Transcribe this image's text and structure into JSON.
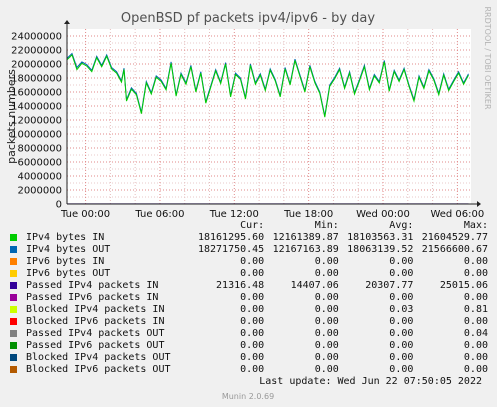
{
  "chart_data": {
    "type": "line",
    "title": "OpenBSD pf packets ipv4/ipv6 - by day",
    "ylabel": "packets numbers",
    "side_label": "RRDTOOL / TOBI OETIKER",
    "ylim": [
      0,
      25000000
    ],
    "yticks": [
      0,
      2000000,
      4000000,
      6000000,
      8000000,
      10000000,
      12000000,
      14000000,
      16000000,
      18000000,
      20000000,
      22000000,
      24000000
    ],
    "ytick_labels": [
      "0",
      "2000000",
      "4000000",
      "6000000",
      "8000000",
      "10000000",
      "12000000",
      "14000000",
      "16000000",
      "18000000",
      "20000000",
      "22000000",
      "24000000"
    ],
    "xlim_hours": [
      -1.5,
      31.1
    ],
    "xticks": [
      {
        "label": "Tue 00:00",
        "hour": 0
      },
      {
        "label": "Tue 06:00",
        "hour": 6
      },
      {
        "label": "Tue 12:00",
        "hour": 12
      },
      {
        "label": "Tue 18:00",
        "hour": 18
      },
      {
        "label": "Wed 00:00",
        "hour": 24
      },
      {
        "label": "Wed 06:00",
        "hour": 30
      }
    ],
    "grid": true,
    "series": [
      {
        "name": "IPv4 bytes IN",
        "color": "#00cc00",
        "x": [
          -1.5,
          -1.1,
          -0.7,
          -0.3,
          0.1,
          0.5,
          0.9,
          1.3,
          1.7,
          2.1,
          2.5,
          2.9,
          3.1,
          3.3,
          3.7,
          4.1,
          4.5,
          4.9,
          5.3,
          5.7,
          6.1,
          6.5,
          6.9,
          7.3,
          7.7,
          8.1,
          8.5,
          8.9,
          9.3,
          9.7,
          10.1,
          10.5,
          10.9,
          11.3,
          11.7,
          12.1,
          12.5,
          12.9,
          13.3,
          13.7,
          14.1,
          14.5,
          14.9,
          15.3,
          15.7,
          16.1,
          16.5,
          16.9,
          17.3,
          17.7,
          18.1,
          18.5,
          18.9,
          19.3,
          19.7,
          20.1,
          20.5,
          20.9,
          21.3,
          21.7,
          22.1,
          22.5,
          22.9,
          23.3,
          23.7,
          24.1,
          24.5,
          24.9,
          25.3,
          25.7,
          26.1,
          26.5,
          26.9,
          27.3,
          27.7,
          28.1,
          28.5,
          28.9,
          29.3,
          29.7,
          30.1,
          30.5,
          30.9
        ],
        "values": [
          20600000,
          21300000,
          19200000,
          20100000,
          19700000,
          18900000,
          20900000,
          19600000,
          21100000,
          19300000,
          18700000,
          17400000,
          19200000,
          14700000,
          16400000,
          15600000,
          12900000,
          17300000,
          15700000,
          18100000,
          17500000,
          16300000,
          20100000,
          15400000,
          18500000,
          17100000,
          19600000,
          16000000,
          18700000,
          14400000,
          16700000,
          19000000,
          17200000,
          20000000,
          15300000,
          18500000,
          17800000,
          15000000,
          19800000,
          17100000,
          18400000,
          16200000,
          19100000,
          17600000,
          15300000,
          19300000,
          17000000,
          20500000,
          18200000,
          16000000,
          19600000,
          17300000,
          15800000,
          12400000,
          16800000,
          17900000,
          19200000,
          16500000,
          18700000,
          15700000,
          17600000,
          19600000,
          16300000,
          18300000,
          17300000,
          20300000,
          16100000,
          18900000,
          17500000,
          19200000,
          16800000,
          14700000,
          18100000,
          16500000,
          19000000,
          17700000,
          15600000,
          18400000,
          16200000,
          17500000,
          18700000,
          17100000,
          18400000
        ]
      },
      {
        "name": "IPv4 bytes OUT",
        "color": "#0066b3",
        "x": [
          -1.5,
          -1.1,
          -0.7,
          -0.3,
          0.1,
          0.5,
          0.9,
          1.3,
          1.7,
          2.1,
          2.5,
          2.9,
          3.1,
          3.3,
          3.7,
          4.1,
          4.5,
          4.9,
          5.3,
          5.7,
          6.1,
          6.5,
          6.9,
          7.3,
          7.7,
          8.1,
          8.5,
          8.9,
          9.3,
          9.7,
          10.1,
          10.5,
          10.9,
          11.3,
          11.7,
          12.1,
          12.5,
          12.9,
          13.3,
          13.7,
          14.1,
          14.5,
          14.9,
          15.3,
          15.7,
          16.1,
          16.5,
          16.9,
          17.3,
          17.7,
          18.1,
          18.5,
          18.9,
          19.3,
          19.7,
          20.1,
          20.5,
          20.9,
          21.3,
          21.7,
          22.1,
          22.5,
          22.9,
          23.3,
          23.7,
          24.1,
          24.5,
          24.9,
          25.3,
          25.7,
          26.1,
          26.5,
          26.9,
          27.3,
          27.7,
          28.1,
          28.5,
          28.9,
          29.3,
          29.7,
          30.1,
          30.5,
          30.9
        ],
        "values": [
          20800000,
          21500000,
          19500000,
          20300000,
          19900000,
          19100000,
          21100000,
          19800000,
          21300000,
          19500000,
          18900000,
          17600000,
          19400000,
          14900000,
          16600000,
          15800000,
          13100000,
          17500000,
          15900000,
          18300000,
          17700000,
          16500000,
          20300000,
          15600000,
          18700000,
          17300000,
          19800000,
          16200000,
          18900000,
          14600000,
          16900000,
          19200000,
          17400000,
          20200000,
          15500000,
          18700000,
          18000000,
          15200000,
          20000000,
          17300000,
          18600000,
          16400000,
          19300000,
          17800000,
          15500000,
          19500000,
          17200000,
          20700000,
          18400000,
          16200000,
          19800000,
          17500000,
          16000000,
          12600000,
          17000000,
          18100000,
          19400000,
          16700000,
          18900000,
          15900000,
          17800000,
          19800000,
          16500000,
          18500000,
          17500000,
          20500000,
          16300000,
          19100000,
          17700000,
          19400000,
          17000000,
          14900000,
          18300000,
          16700000,
          19200000,
          17900000,
          15800000,
          18600000,
          16400000,
          17700000,
          18900000,
          17300000,
          18600000
        ]
      },
      {
        "name": "IPv6 bytes IN",
        "color": "#ff8000",
        "x": [
          -1.5,
          30.9
        ],
        "values": [
          0,
          0
        ]
      },
      {
        "name": "IPv6 bytes OUT",
        "color": "#ffcc00",
        "x": [
          -1.5,
          30.9
        ],
        "values": [
          0,
          0
        ]
      },
      {
        "name": "Passed IPv4 packets IN",
        "color": "#330099",
        "x": [
          -1.5,
          30.9
        ],
        "values": [
          21316,
          21316
        ]
      },
      {
        "name": "Passed IPv6 packets IN",
        "color": "#990099",
        "x": [
          -1.5,
          30.9
        ],
        "values": [
          0,
          0
        ]
      },
      {
        "name": "Blocked IPv4 packets IN",
        "color": "#ccff00",
        "x": [
          -1.5,
          30.9
        ],
        "values": [
          0,
          0
        ]
      },
      {
        "name": "Blocked IPv6 packets IN",
        "color": "#ff0000",
        "x": [
          -1.5,
          30.9
        ],
        "values": [
          0,
          0
        ]
      },
      {
        "name": "Passed IPv4 packets OUT",
        "color": "#808080",
        "x": [
          -1.5,
          30.9
        ],
        "values": [
          0,
          0
        ]
      },
      {
        "name": "Passed IPv6 packets OUT",
        "color": "#008f00",
        "x": [
          -1.5,
          30.9
        ],
        "values": [
          0,
          0
        ]
      },
      {
        "name": "Blocked IPv4 packets OUT",
        "color": "#00487d",
        "x": [
          -1.5,
          30.9
        ],
        "values": [
          0,
          0
        ]
      },
      {
        "name": "Blocked IPv6 packets OUT",
        "color": "#b35a00",
        "x": [
          -1.5,
          30.9
        ],
        "values": [
          0,
          0
        ]
      }
    ]
  },
  "legend": {
    "headers": {
      "cur": "Cur:",
      "min": "Min:",
      "avg": "Avg:",
      "max": "Max:"
    },
    "rows": [
      {
        "name": "IPv4 bytes IN",
        "color": "#00cc00",
        "cur": "18161295.60",
        "min": "12161389.87",
        "avg": "18103563.31",
        "max": "21604529.77"
      },
      {
        "name": "IPv4 bytes OUT",
        "color": "#0066b3",
        "cur": "18271750.45",
        "min": "12167163.89",
        "avg": "18063139.52",
        "max": "21566600.67"
      },
      {
        "name": "IPv6 bytes IN",
        "color": "#ff8000",
        "cur": "0.00",
        "min": "0.00",
        "avg": "0.00",
        "max": "0.00"
      },
      {
        "name": "IPv6 bytes OUT",
        "color": "#ffcc00",
        "cur": "0.00",
        "min": "0.00",
        "avg": "0.00",
        "max": "0.00"
      },
      {
        "name": "Passed IPv4 packets IN",
        "color": "#330099",
        "cur": "21316.48",
        "min": "14407.06",
        "avg": "20307.77",
        "max": "25015.06"
      },
      {
        "name": "Passed IPv6 packets IN",
        "color": "#990099",
        "cur": "0.00",
        "min": "0.00",
        "avg": "0.00",
        "max": "0.00"
      },
      {
        "name": "Blocked IPv4 packets IN",
        "color": "#ccff00",
        "cur": "0.00",
        "min": "0.00",
        "avg": "0.03",
        "max": "0.81"
      },
      {
        "name": "Blocked IPv6 packets IN",
        "color": "#ff0000",
        "cur": "0.00",
        "min": "0.00",
        "avg": "0.00",
        "max": "0.00"
      },
      {
        "name": "Passed IPv4 packets OUT",
        "color": "#808080",
        "cur": "0.00",
        "min": "0.00",
        "avg": "0.00",
        "max": "0.04"
      },
      {
        "name": "Passed IPv6 packets OUT",
        "color": "#008f00",
        "cur": "0.00",
        "min": "0.00",
        "avg": "0.00",
        "max": "0.00"
      },
      {
        "name": "Blocked IPv4 packets OUT",
        "color": "#00487d",
        "cur": "0.00",
        "min": "0.00",
        "avg": "0.00",
        "max": "0.00"
      },
      {
        "name": "Blocked IPv6 packets OUT",
        "color": "#b35a00",
        "cur": "0.00",
        "min": "0.00",
        "avg": "0.00",
        "max": "0.00"
      }
    ]
  },
  "last_update": "Last update: Wed Jun 22 07:50:05 2022",
  "footer": "Munin 2.0.69"
}
